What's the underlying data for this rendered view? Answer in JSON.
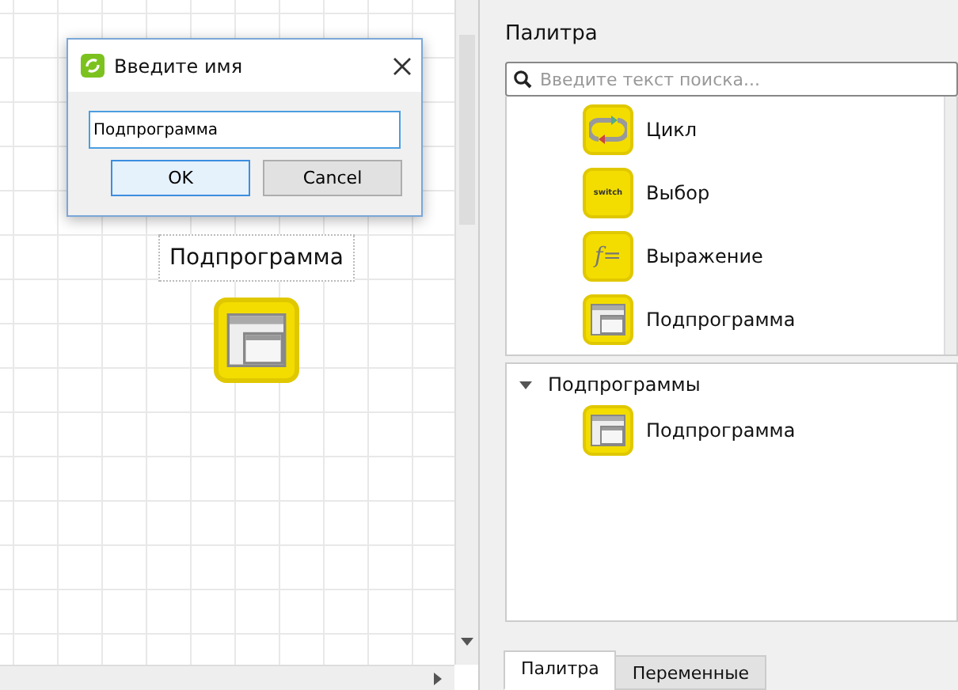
{
  "dialog": {
    "title": "Введите имя",
    "value": "Подпрограмма",
    "buttons": [
      {
        "label": "OK",
        "default": true
      },
      {
        "label": "Cancel",
        "default": false
      }
    ]
  },
  "canvas": {
    "nodes": [
      {
        "label": "Подпрограмма",
        "kind": "window"
      }
    ]
  },
  "palette": {
    "title": "Палитра",
    "search": {
      "placeholder": "Введите текст поиска..."
    },
    "items": [
      {
        "label": "Цикл",
        "kind": "loop"
      },
      {
        "label": "Выбор",
        "kind": "switch",
        "icon_text": "switch"
      },
      {
        "label": "Выражение",
        "kind": "expression",
        "icon_text": "f="
      },
      {
        "label": "Подпрограмма",
        "kind": "window"
      }
    ],
    "groups": [
      {
        "label": "Подпрограммы",
        "expanded": true,
        "children": [
          {
            "label": "Подпрограмма",
            "kind": "window"
          }
        ]
      }
    ]
  },
  "tabs": [
    {
      "label": "Палитра",
      "selected": true
    },
    {
      "label": "Переменные",
      "selected": false
    }
  ]
}
